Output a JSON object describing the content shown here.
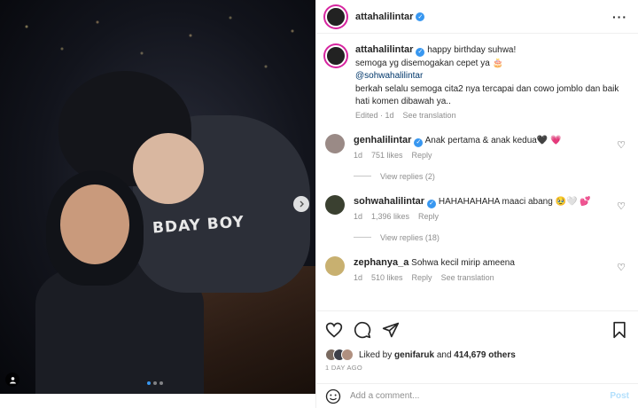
{
  "post": {
    "author": "attahalilintar",
    "photo_text": "BDAY BOY",
    "carousel": {
      "count": 3,
      "active": 1
    }
  },
  "caption": {
    "username": "attahalilintar",
    "line1": "happy birthday suhwa!",
    "line2": "semoga yg disemogakan cepet ya 🎂",
    "mention": "@sohwahalilintar",
    "line3": "berkah selalu semoga cita2 nya tercapai dan cowo jomblo dan baik hati komen dibawah ya..",
    "edited": "Edited · 1d",
    "see_translation": "See translation"
  },
  "comments": [
    {
      "username": "genhalilintar",
      "text": "Anak pertama & anak kedua🖤 💗",
      "time": "1d",
      "likes": "751 likes",
      "reply": "Reply",
      "view_replies": "View replies (2)"
    },
    {
      "username": "sohwahalilintar",
      "text": "HAHAHAHAHA maaci abang 🥹🤍 💕",
      "time": "1d",
      "likes": "1,396 likes",
      "reply": "Reply",
      "view_replies": "View replies (18)"
    },
    {
      "username": "zephanya_a",
      "text": "Sohwa kecil mirip ameena",
      "time": "1d",
      "likes": "510 likes",
      "reply": "Reply",
      "see_translation": "See translation"
    }
  ],
  "likes_line": {
    "prefix": "Liked by",
    "user": "genifaruk",
    "joiner": "and",
    "count": "414,679 others"
  },
  "timestamp": "1 DAY AGO",
  "add_comment": {
    "placeholder": "Add a comment...",
    "post_label": "Post"
  },
  "colors": {
    "verified": "#3897f0",
    "link": "#00376b",
    "muted": "#8e8e8e",
    "post_disabled": "#b2dffc",
    "story_ring": "#d6249f"
  },
  "icons": [
    "more-icon",
    "heart-icon",
    "comment-icon",
    "share-icon",
    "bookmark-icon",
    "emoji-icon",
    "tag-user-icon",
    "chevron-right-icon",
    "verified-icon"
  ]
}
